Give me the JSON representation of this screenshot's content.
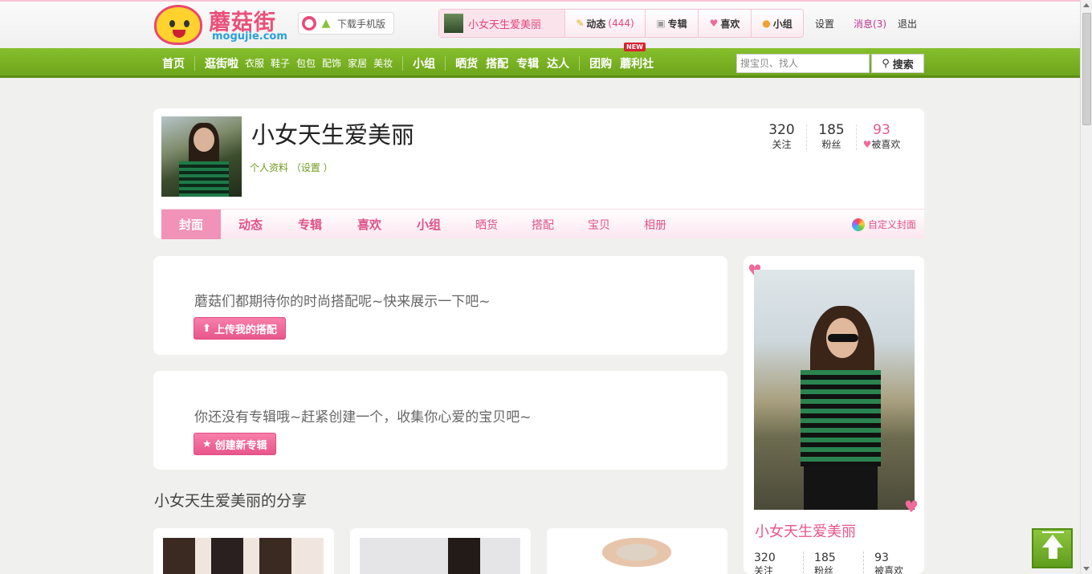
{
  "header": {
    "logo_cn": "蘑菇街",
    "logo_en": "mogujie.com",
    "app_download": "下载手机版",
    "user_name": "小女天生爱美丽",
    "dynamic_label": "动态",
    "dynamic_count": "(444)",
    "album_label": "专辑",
    "like_label": "喜欢",
    "group_label": "小组",
    "settings": "设置",
    "messages": "消息(3)",
    "logout": "退出"
  },
  "nav": {
    "home": "首页",
    "shop": "逛街啦",
    "sub": [
      "衣服",
      "鞋子",
      "包包",
      "配饰",
      "家居",
      "美妆"
    ],
    "group": "小组",
    "show": "晒货",
    "match": "搭配",
    "album": "专辑",
    "expert": "达人",
    "tuan": "团购",
    "benefit": "蘑利社",
    "new_badge": "NEW",
    "search_placeholder": "搜宝贝、找人",
    "search_button": "搜索"
  },
  "profile": {
    "name": "小女天生爱美丽",
    "info_link": "个人资料",
    "settings_link": "（设置 ）",
    "stats": [
      {
        "value": "320",
        "label": "关注"
      },
      {
        "value": "185",
        "label": "粉丝"
      },
      {
        "value": "93",
        "label": "被喜欢"
      }
    ],
    "tabs": [
      "封面",
      "动态",
      "专辑",
      "喜欢",
      "小组",
      "晒货",
      "搭配",
      "宝贝",
      "相册"
    ],
    "custom_cover": "自定义封面"
  },
  "main": {
    "outfit_msg": "蘑菇们都期待你的时尚搭配呢~快来展示一下吧~",
    "outfit_btn": "上传我的搭配",
    "album_msg": "你还没有专辑哦~赶紧创建一个，收集你心爱的宝贝吧~",
    "album_btn": "创建新专辑",
    "share_title": "小女天生爱美丽的分享"
  },
  "sidebar": {
    "name": "小女天生爱美丽",
    "stats": [
      {
        "value": "320",
        "label": "关注"
      },
      {
        "value": "185",
        "label": "粉丝"
      },
      {
        "value": "93",
        "label": "被喜欢"
      }
    ]
  },
  "colors": {
    "brand_pink": "#e9568a",
    "nav_green": "#7ab325",
    "active_tab": "#f192b8"
  }
}
